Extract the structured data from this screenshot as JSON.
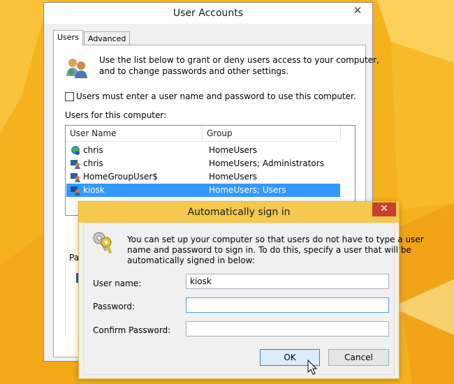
{
  "user_accounts": {
    "title": "User Accounts",
    "tabs": [
      {
        "label": "Users"
      },
      {
        "label": "Advanced"
      }
    ],
    "intro_text": [
      "Use the list below to grant or deny users access to your computer,",
      "and to change passwords and other settings."
    ],
    "require_login_checkbox": {
      "label": "Users must enter a user name and password to use this computer.",
      "checked": false
    },
    "users_label": "Users for this computer:",
    "columns": [
      "User Name",
      "Group"
    ],
    "rows": [
      {
        "name": "chris",
        "group": "HomeUsers",
        "selected": false
      },
      {
        "name": "chris",
        "group": "HomeUsers; Administrators",
        "selected": false
      },
      {
        "name": "HomeGroupUser$",
        "group": "HomeUsers",
        "selected": false
      },
      {
        "name": "kiosk",
        "group": "HomeUsers; Users",
        "selected": true
      }
    ],
    "partial_label": "Pa"
  },
  "auto_signin": {
    "title": "Automatically sign in",
    "description": [
      "You can set up your computer so that users do not have to type a user",
      "name and password to sign in. To do this, specify a user that will be",
      "automatically signed in below:"
    ],
    "username_label": "User name:",
    "username_value": "kiosk",
    "password_label": "Password:",
    "password_value": "",
    "confirm_label": "Confirm Password:",
    "confirm_value": "",
    "ok_label": "OK",
    "cancel_label": "Cancel"
  },
  "icons": [
    "users-icon",
    "keys-icon",
    "close-icon",
    "mouse-cursor-icon"
  ],
  "colors": {
    "desktop": "#f6b21e",
    "dialog_title": "#f4c94d",
    "close_button": "#c7402b",
    "selection": "#3399ff"
  }
}
